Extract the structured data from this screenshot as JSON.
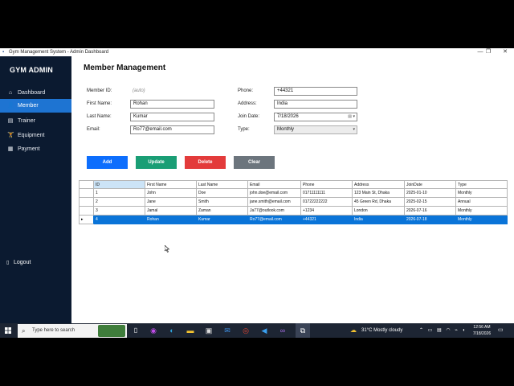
{
  "window": {
    "title": "Gym Management System - Admin Dashboard",
    "minimize": "—",
    "maximize": "❐",
    "close": "✕"
  },
  "sidebar": {
    "brand": "GYM ADMIN",
    "items": [
      {
        "label": "Dashboard",
        "icon": "⌂"
      },
      {
        "label": "Member",
        "icon": "👤"
      },
      {
        "label": "Trainer",
        "icon": "▤"
      },
      {
        "label": "Equipment",
        "icon": "🏋"
      },
      {
        "label": "Payment",
        "icon": "▦"
      }
    ],
    "logout": {
      "label": "Logout",
      "icon": "▯"
    }
  },
  "main": {
    "title": "Member Management",
    "form": {
      "member_id_label": "Member ID:",
      "member_id_value": "(auto)",
      "first_name_label": "First Name:",
      "first_name_value": "Rohan",
      "last_name_label": "Last Name:",
      "last_name_value": "Kumar",
      "email_label": "Email:",
      "email_value": "Ro77@email.com",
      "phone_label": "Phone:",
      "phone_value": "+44321",
      "address_label": "Address:",
      "address_value": "India",
      "join_date_label": "Join Date:",
      "join_date_value": "7/18/2026",
      "type_label": "Type:",
      "type_value": "Monthly"
    },
    "buttons": {
      "add": "Add",
      "update": "Update",
      "delete": "Delete",
      "clear": "Clear"
    },
    "table": {
      "headers": [
        "ID",
        "First Name",
        "Last Name",
        "Email",
        "Phone",
        "Address",
        "JoinDate",
        "Type"
      ],
      "rows": [
        [
          "1",
          "John",
          "Doe",
          "john.doe@email.com",
          "01711111111",
          "123 Main St, Dhaka",
          "2025-01-10",
          "Monthly"
        ],
        [
          "2",
          "Jane",
          "Smith",
          "jane.smith@email.com",
          "01722222222",
          "45 Green Rd, Dhaka",
          "2025-02-15",
          "Annual"
        ],
        [
          "3",
          "Jamal",
          "Zaman",
          "Ja77@outlook.com",
          "+1234",
          "London",
          "2026-07-16",
          "Monthly"
        ],
        [
          "4",
          "Rohan",
          "Kumar",
          "Ro77@email.com",
          "+44321",
          "India",
          "2026-07-18",
          "Monthly"
        ]
      ],
      "selected_row": 3,
      "row_marker": "▸"
    }
  },
  "taskbar": {
    "search_placeholder": "Type here to search",
    "weather": "31°C  Mostly cloudy",
    "time": "12:56 AM",
    "date": "7/18/2026"
  },
  "colors": {
    "sidebar_bg": "#0b1a30",
    "active_nav": "#1e74d2",
    "add": "#0d6efd",
    "update": "#1a9e75",
    "delete": "#e33b3b",
    "clear": "#6c757d",
    "selected_row": "#0a74d8"
  }
}
